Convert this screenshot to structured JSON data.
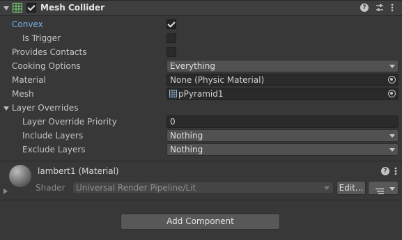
{
  "component": {
    "title": "Mesh Collider",
    "enabled": true
  },
  "fields": {
    "convex": {
      "label": "Convex",
      "checked": true
    },
    "is_trigger": {
      "label": "Is Trigger",
      "checked": false
    },
    "provides_contacts": {
      "label": "Provides Contacts",
      "checked": false
    },
    "cooking_options": {
      "label": "Cooking Options",
      "value": "Everything"
    },
    "material": {
      "label": "Material",
      "value": "None (Physic Material)"
    },
    "mesh": {
      "label": "Mesh",
      "value": "pPyramid1"
    }
  },
  "layer_overrides": {
    "label": "Layer Overrides",
    "priority": {
      "label": "Layer Override Priority",
      "value": "0"
    },
    "include": {
      "label": "Include Layers",
      "value": "Nothing"
    },
    "exclude": {
      "label": "Exclude Layers",
      "value": "Nothing"
    }
  },
  "material_section": {
    "title": "lambert1 (Material)",
    "shader_label": "Shader",
    "shader_value": "Universal Render Pipeline/Lit",
    "edit_label": "Edit..."
  },
  "add_component_label": "Add Component",
  "colors": {
    "convex_label": "#7bafe8"
  }
}
